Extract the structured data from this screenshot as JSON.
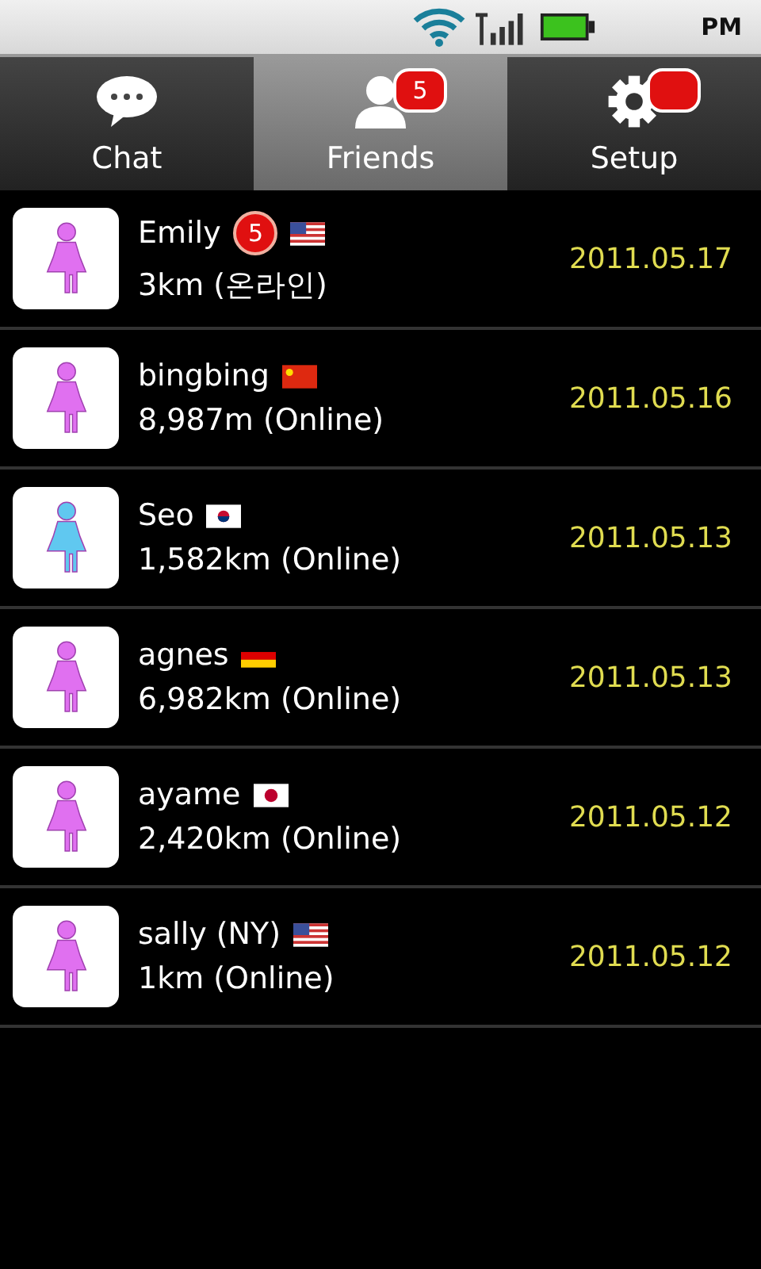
{
  "status_bar": {
    "time": "PM"
  },
  "tabs": [
    {
      "label": "Chat",
      "kind": "chat",
      "selected": false
    },
    {
      "label": "Friends",
      "kind": "friends",
      "selected": true,
      "badge": "5"
    },
    {
      "label": "Setup",
      "kind": "gear",
      "selected": false,
      "has_badge": true
    }
  ],
  "friends": [
    {
      "name": "Emily",
      "badge": "5",
      "kind": "us",
      "distance": "3km (온라인)",
      "date": "2011.05.17",
      "color": "#e070f0"
    },
    {
      "name": "bingbing",
      "kind": "cn",
      "distance": "8,987m (Online)",
      "date": "2011.05.16",
      "color": "#e070f0"
    },
    {
      "name": "Seo",
      "kind": "kr",
      "distance": "1,582km (Online)",
      "date": "2011.05.13",
      "color": "#60c8f0"
    },
    {
      "name": "agnes",
      "kind": "de",
      "distance": "6,982km (Online)",
      "date": "2011.05.13",
      "color": "#e070f0"
    },
    {
      "name": "ayame",
      "kind": "jp",
      "distance": "2,420km (Online)",
      "date": "2011.05.12",
      "color": "#e070f0"
    },
    {
      "name": "sally (NY)",
      "kind": "us",
      "distance": "1km (Online)",
      "date": "2011.05.12",
      "color": "#e070f0"
    }
  ]
}
